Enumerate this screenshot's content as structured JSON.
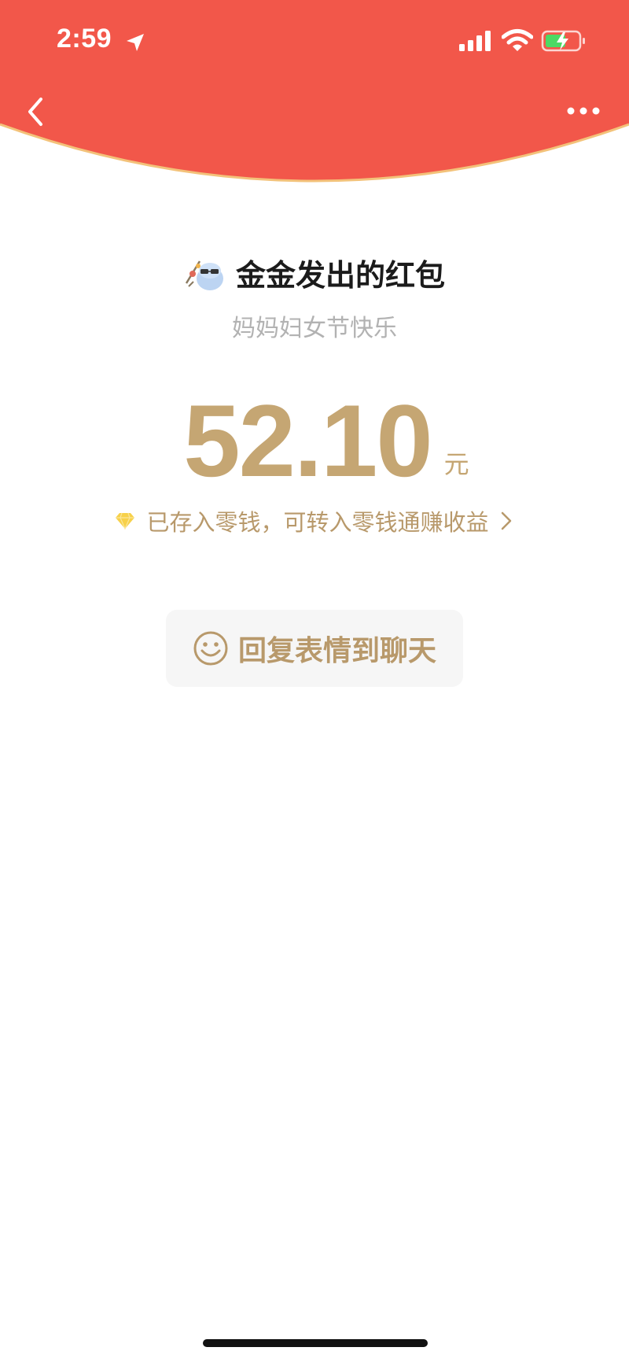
{
  "status_bar": {
    "time": "2:59"
  },
  "header": {
    "background_color": "#f2574a",
    "border_color": "#f3c27a"
  },
  "nav": {
    "back_icon": "chevron-left-icon",
    "more_icon": "more-horizontal-icon"
  },
  "red_packet": {
    "sender_title": "金金发出的红包",
    "blessing": "妈妈妇女节快乐",
    "amount": "52.10",
    "unit": "元",
    "deposit_note": "已存入零钱，可转入零钱通赚收益",
    "reply_button_label": "回复表情到聊天"
  },
  "colors": {
    "accent_gold": "#c5a673",
    "secondary_gold": "#b8996b",
    "muted_text": "#b2b2b2"
  }
}
